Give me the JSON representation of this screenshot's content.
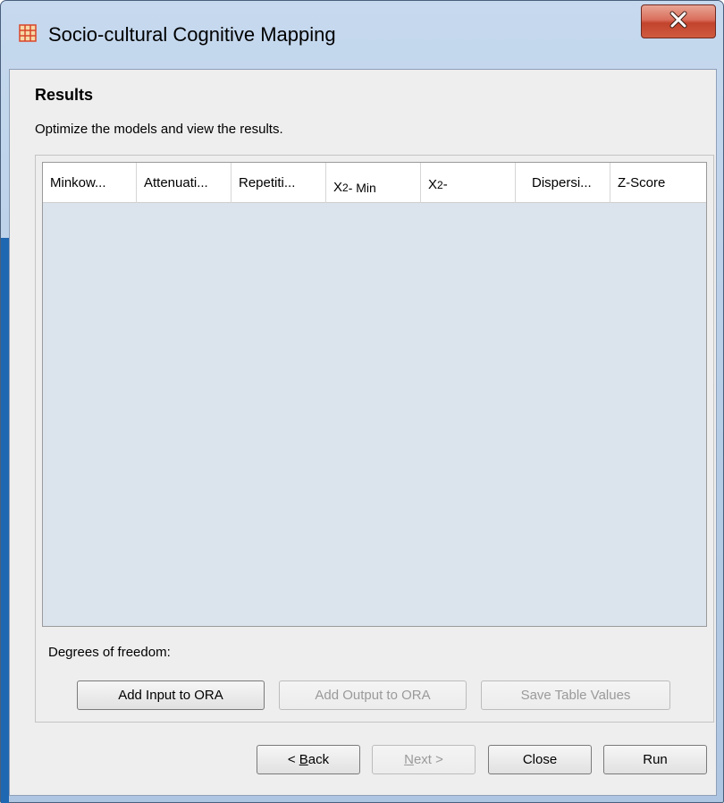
{
  "window": {
    "title": "Socio-cultural Cognitive Mapping",
    "icon": "ora-grid-icon",
    "close_label": "X"
  },
  "page": {
    "heading": "Results",
    "subheading": "Optimize the models and view the results."
  },
  "table": {
    "columns": [
      {
        "label": "Minkow...",
        "sup": ""
      },
      {
        "label": "Attenuati...",
        "sup": ""
      },
      {
        "label": "Repetiti...",
        "sup": ""
      },
      {
        "label": "X",
        "sup": "2",
        "suffix": " - Min"
      },
      {
        "label": "X",
        "sup": "2",
        "suffix": " -"
      },
      {
        "label": "Dispersi...",
        "sup": ""
      },
      {
        "label": "Z-Score",
        "sup": ""
      }
    ],
    "rows": []
  },
  "degrees_of_freedom_label": "Degrees of freedom:",
  "action_buttons": {
    "add_input": "Add Input to ORA",
    "add_output": "Add Output to ORA",
    "save_table": "Save Table Values"
  },
  "nav_buttons": {
    "back_prefix": "< ",
    "back_mnemonic": "B",
    "back_rest": "ack",
    "next_mnemonic": "N",
    "next_rest": "ext >",
    "close": "Close",
    "run": "Run"
  },
  "colors": {
    "icon_accent": "#d9452b",
    "close_button": "#c2432c"
  }
}
